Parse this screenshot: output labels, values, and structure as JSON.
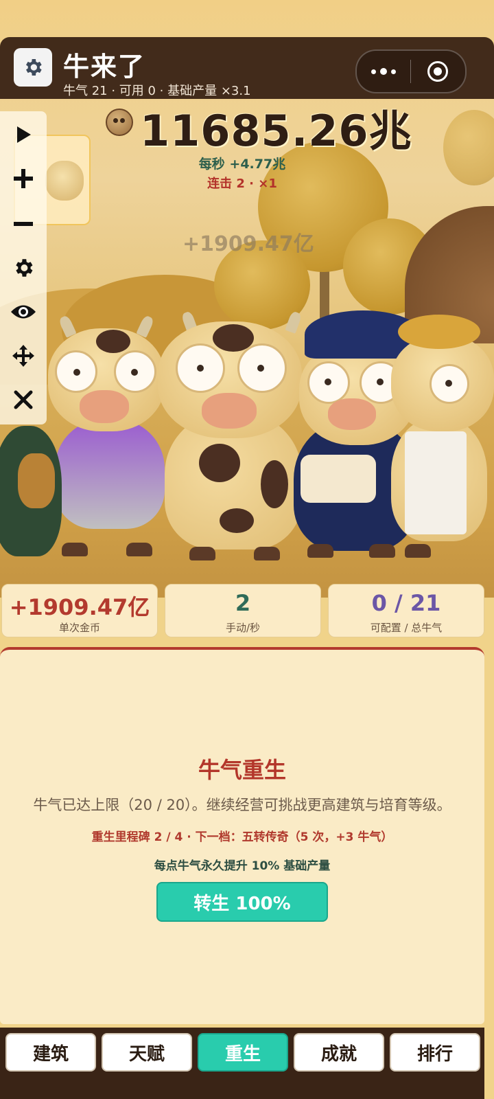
{
  "header": {
    "title": "牛来了",
    "subtitle": "牛气 21 · 可用 0 · 基础产量 ×3.1"
  },
  "score": {
    "total_coins": "11685.26兆",
    "per_second": "每秒 +4.77兆",
    "combo": "连击 2 · ×1",
    "floating_gain": "+1909.47亿"
  },
  "stats": [
    {
      "value": "+1909.47亿",
      "label": "单次金币",
      "color": "#b33a2e"
    },
    {
      "value": "2",
      "label": "手动/秒",
      "color": "#2f6b58"
    },
    {
      "value": "0 / 21",
      "label": "可配置 / 总牛气",
      "color": "#6b56a6"
    }
  ],
  "rebirth_panel": {
    "title": "牛气重生",
    "description": "牛气已达上限（20 / 20）。继续经营可挑战更高建筑与培育等级。",
    "milestone": "重生里程碑 2 / 4 · 下一档：五转传奇（5 次，+3 牛气）",
    "bonus": "每点牛气永久提升 10% 基础产量",
    "button_label": "转生 100%"
  },
  "nav": {
    "tabs": [
      {
        "label": "建筑",
        "active": false
      },
      {
        "label": "天赋",
        "active": false
      },
      {
        "label": "重生",
        "active": true
      },
      {
        "label": "成就",
        "active": false
      },
      {
        "label": "排行",
        "active": false
      }
    ]
  },
  "toolbar_icons": [
    "play-icon",
    "plus-icon",
    "minus-icon",
    "gear-icon",
    "eye-icon",
    "move-icon",
    "close-icon"
  ],
  "colors": {
    "accent": "#29ccad",
    "header_bg": "#3a2416",
    "danger": "#b33a2e",
    "panel_bg": "#faebc6"
  }
}
